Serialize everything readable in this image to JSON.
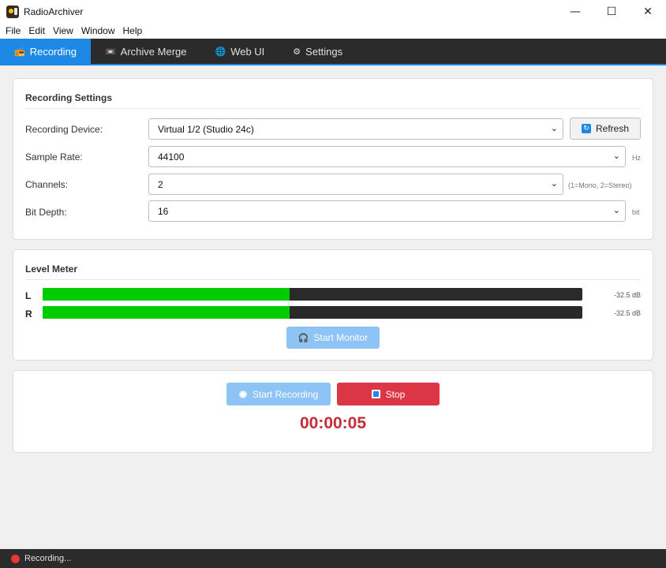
{
  "window": {
    "title": "RadioArchiver",
    "controls": {
      "minimize": "—",
      "maximize": "☐",
      "close": "✕"
    }
  },
  "menu": [
    "File",
    "Edit",
    "View",
    "Window",
    "Help"
  ],
  "tabs": [
    {
      "label": "Recording",
      "icon": "radio-icon",
      "active": true
    },
    {
      "label": "Archive Merge",
      "icon": "archive-icon",
      "active": false
    },
    {
      "label": "Web UI",
      "icon": "globe-icon",
      "active": false
    },
    {
      "label": "Settings",
      "icon": "gear-icon",
      "active": false
    }
  ],
  "recording_settings": {
    "title": "Recording Settings",
    "device": {
      "label": "Recording Device:",
      "value": "Virtual 1/2 (Studio 24c)"
    },
    "refresh_label": "Refresh",
    "sample_rate": {
      "label": "Sample Rate:",
      "value": "44100",
      "unit": "Hz"
    },
    "channels": {
      "label": "Channels:",
      "value": "2",
      "unit": "(1=Mono, 2=Stereo)"
    },
    "bit_depth": {
      "label": "Bit Depth:",
      "value": "16",
      "unit": "bit"
    }
  },
  "level_meter": {
    "title": "Level Meter",
    "channels": [
      {
        "name": "L",
        "db": "-32.5 dB",
        "level": 0.458
      },
      {
        "name": "R",
        "db": "-32.5 dB",
        "level": 0.458
      }
    ],
    "monitor_label": "Start Monitor"
  },
  "controls": {
    "start_label": "Start Recording",
    "stop_label": "Stop",
    "timer": "00:00:05"
  },
  "status": {
    "text": "Recording..."
  },
  "colors": {
    "accent": "#1e88e5",
    "meter": "#00cc00",
    "stop": "#dc3545",
    "timer": "#c62b3a",
    "status_dot": "#e53935"
  }
}
